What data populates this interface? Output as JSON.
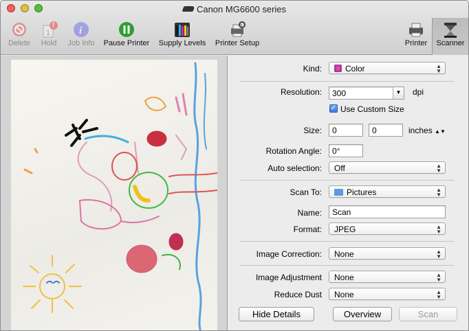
{
  "window": {
    "title": "Canon MG6600 series"
  },
  "toolbar": {
    "items": [
      {
        "label": "Delete",
        "icon": "delete-icon"
      },
      {
        "label": "Hold",
        "icon": "hold-icon"
      },
      {
        "label": "Job Info",
        "icon": "info-icon"
      },
      {
        "label": "Pause Printer",
        "icon": "pause-icon"
      },
      {
        "label": "Supply Levels",
        "icon": "supply-levels-icon"
      },
      {
        "label": "Printer Setup",
        "icon": "printer-setup-icon"
      },
      {
        "label": "Printer",
        "icon": "printer-icon"
      },
      {
        "label": "Scanner",
        "icon": "scanner-icon"
      }
    ],
    "hold_badge": "!"
  },
  "settings": {
    "kind_label": "Kind:",
    "kind_value": "Color",
    "resolution_label": "Resolution:",
    "resolution_value": "300",
    "resolution_unit": "dpi",
    "custom_size_label": "Use Custom Size",
    "size_label": "Size:",
    "size_width": "0",
    "size_height": "0",
    "size_unit": "inches",
    "rotation_label": "Rotation Angle:",
    "rotation_value": "0°",
    "auto_selection_label": "Auto selection:",
    "auto_selection_value": "Off",
    "scan_to_label": "Scan To:",
    "scan_to_value": "Pictures",
    "name_label": "Name:",
    "name_value": "Scan",
    "format_label": "Format:",
    "format_value": "JPEG",
    "image_correction_label": "Image Correction:",
    "image_correction_value": "None",
    "image_adjustment_label": "Image Adjustment",
    "image_adjustment_value": "None",
    "reduce_dust_label": "Reduce Dust",
    "reduce_dust_value": "None"
  },
  "buttons": {
    "hide_details": "Hide Details",
    "overview": "Overview",
    "scan": "Scan"
  },
  "colors": {
    "accent": "#3b7de0",
    "pause_green": "#2f9e2f"
  }
}
